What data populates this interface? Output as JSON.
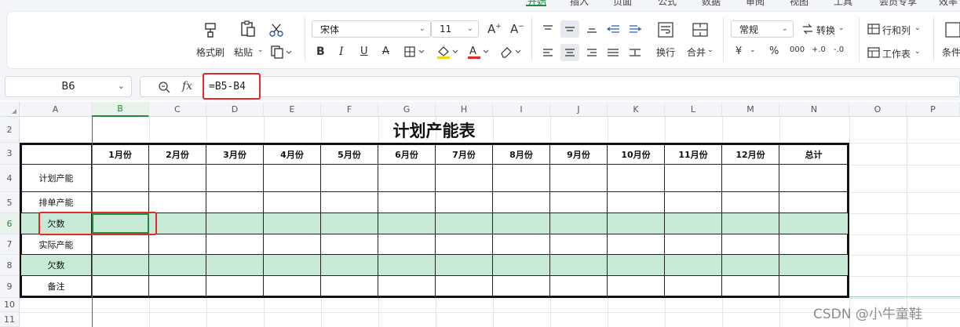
{
  "menu": {
    "tabs": [
      "开始",
      "插入",
      "页面",
      "公式",
      "数据",
      "审阅",
      "视图",
      "工具",
      "会员专享",
      "效率"
    ],
    "active": "开始"
  },
  "ribbon": {
    "format_painter": "格式刷",
    "paste": "粘贴",
    "font_name": "宋体",
    "font_size": "11",
    "number_format": "常规",
    "convert": "转换",
    "wrap": "换行",
    "merge": "合并",
    "rows_cols": "行和列",
    "worksheet": "工作表",
    "conditional": "条件",
    "currency_symbol": "¥",
    "percent_symbol": "%",
    "thousands_symbol": "000",
    "dec_increase": "+.0",
    "dec_decrease": "-.0"
  },
  "formula_bar": {
    "cell_ref": "B6",
    "fx": "fx",
    "formula": "=B5-B4"
  },
  "grid": {
    "columns": [
      "A",
      "B",
      "C",
      "D",
      "E",
      "F",
      "G",
      "H",
      "I",
      "J",
      "K",
      "L",
      "M",
      "N",
      "O",
      "P"
    ],
    "selected_column": "B",
    "rows": [
      "2",
      "3",
      "4",
      "5",
      "6",
      "7",
      "8",
      "9",
      "10",
      "11"
    ],
    "selected_row": "6"
  },
  "sheet": {
    "title": "计划产能表",
    "header_row": [
      "",
      "1月份",
      "2月份",
      "3月份",
      "4月份",
      "5月份",
      "6月份",
      "7月份",
      "8月份",
      "9月份",
      "10月份",
      "11月份",
      "12月份",
      "总计"
    ],
    "row_labels": [
      "计划产能",
      "排单产能",
      "欠数",
      "实际产能",
      "欠数",
      "备注"
    ],
    "highlight_rows": [
      2,
      4
    ],
    "highlight_color": "#c6ead6"
  },
  "colors": {
    "accent": "#1f8b3f",
    "annotation_red": "#e02b2b"
  },
  "watermark": "CSDN @小牛童鞋"
}
